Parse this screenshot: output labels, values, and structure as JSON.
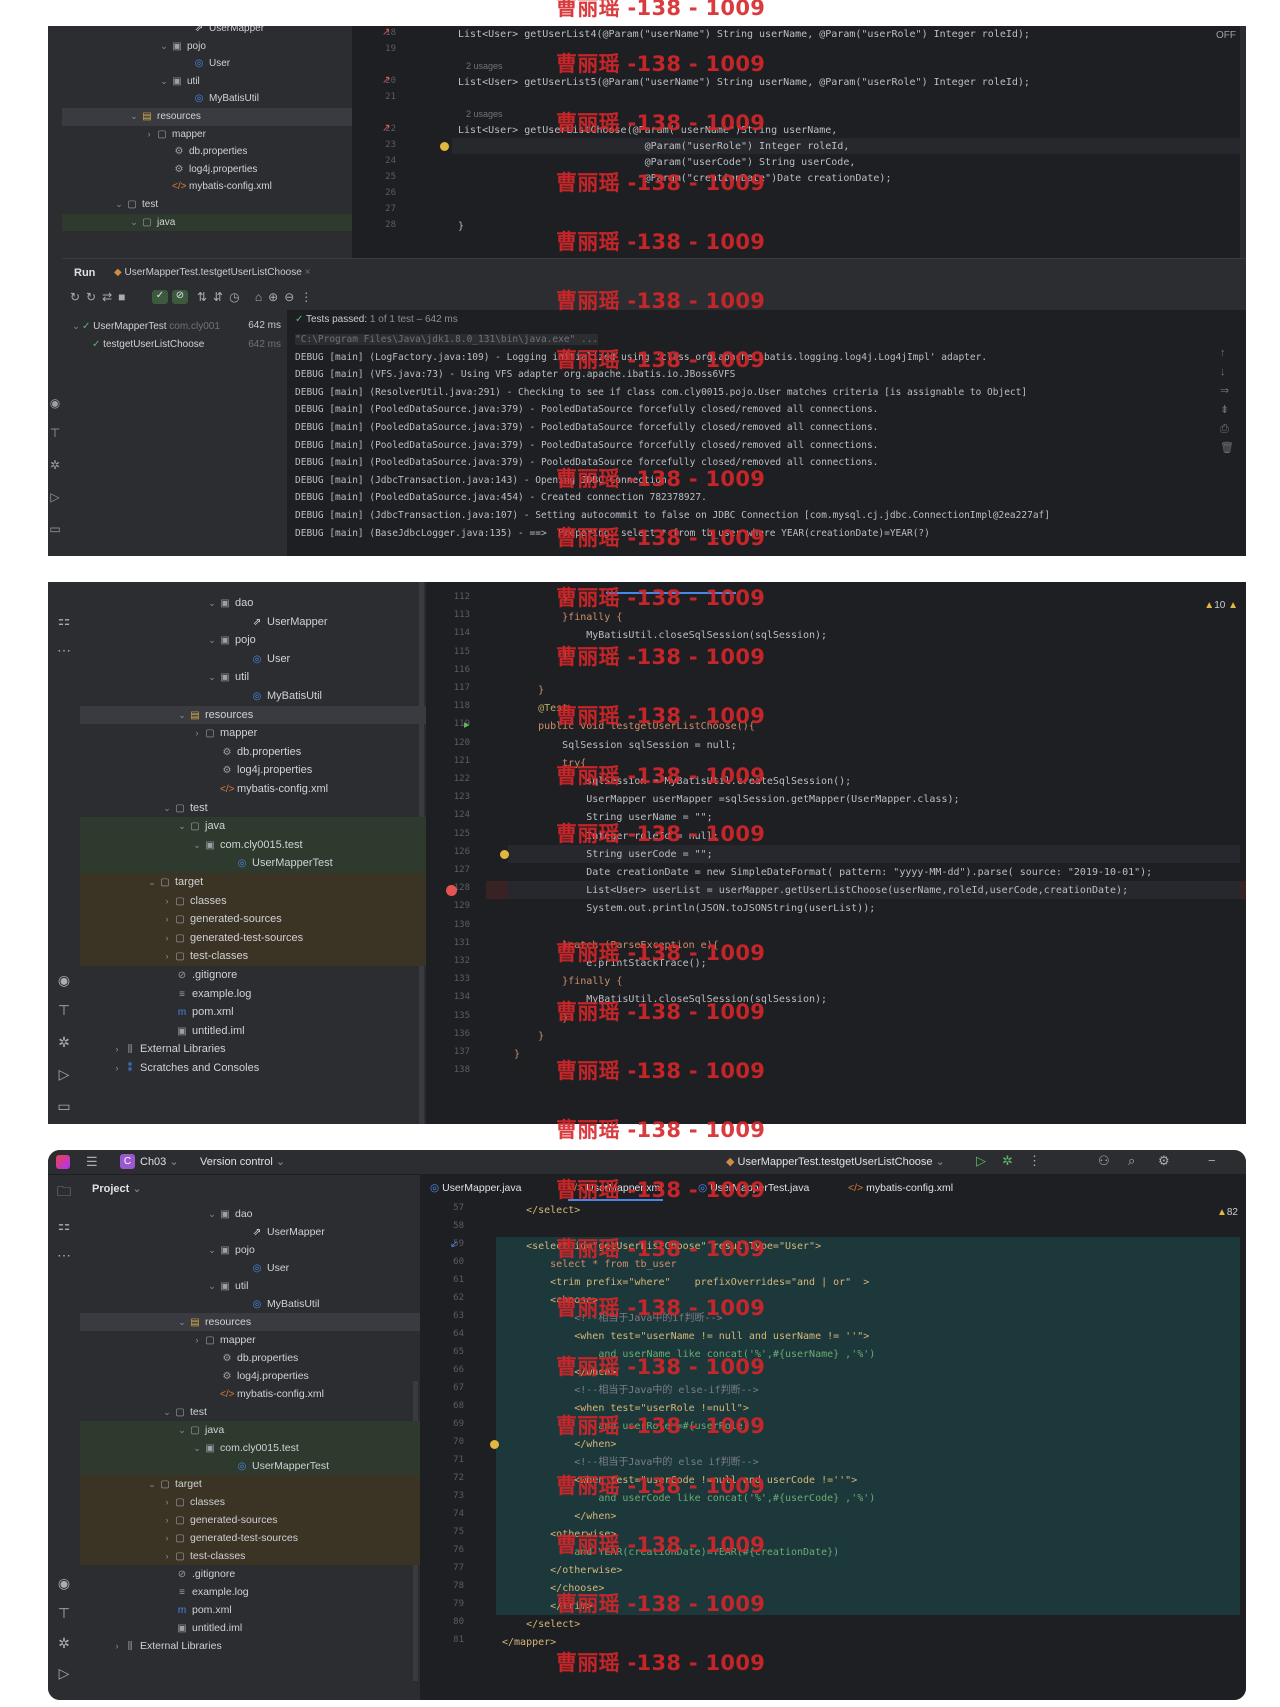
{
  "watermark": "曹丽瑶 -138 - 1009",
  "panel1": {
    "tree": [
      {
        "label": "UserMapper",
        "indent": 130,
        "icon": "mapper"
      },
      {
        "label": "pojo",
        "indent": 110,
        "icon": "pkg",
        "arrow": "v"
      },
      {
        "label": "User",
        "indent": 130,
        "icon": "class"
      },
      {
        "label": "util",
        "indent": 110,
        "icon": "pkg",
        "arrow": "v"
      },
      {
        "label": "MyBatisUtil",
        "indent": 130,
        "icon": "class"
      },
      {
        "label": "resources",
        "indent": 80,
        "icon": "res",
        "arrow": "v",
        "sel": true
      },
      {
        "label": "mapper",
        "indent": 95,
        "icon": "folder",
        "arrow": ">"
      },
      {
        "label": "db.properties",
        "indent": 110,
        "icon": "prop"
      },
      {
        "label": "log4j.properties",
        "indent": 110,
        "icon": "prop"
      },
      {
        "label": "mybatis-config.xml",
        "indent": 110,
        "icon": "xml"
      },
      {
        "label": "test",
        "indent": 65,
        "icon": "folder",
        "arrow": "v"
      },
      {
        "label": "java",
        "indent": 80,
        "icon": "folder",
        "arrow": "v",
        "green": true
      }
    ],
    "lines": [
      {
        "n": "18",
        "text": "List<User> getUserList4(@Param(\"userName\") String userName, @Param(\"userRole\") Integer roleId);"
      },
      {
        "n": "19",
        "text": ""
      },
      {
        "n": "",
        "hint": "2 usages"
      },
      {
        "n": "20",
        "text": "List<User> getUserList5(@Param(\"userName\") String userName, @Param(\"userRole\") Integer roleId);"
      },
      {
        "n": "21",
        "text": ""
      },
      {
        "n": "",
        "hint": "2 usages"
      },
      {
        "n": "22",
        "text": "List<User> getUserListChoose(@Param(\"userName\")String userName,"
      },
      {
        "n": "23",
        "text": "                               @Param(\"userRole\") Integer roleId,"
      },
      {
        "n": "24",
        "text": "                               @Param(\"userCode\") String userCode,"
      },
      {
        "n": "25",
        "text": "                               @Param(\"creationDate\")Date creationDate);"
      },
      {
        "n": "26",
        "text": ""
      },
      {
        "n": "27",
        "text": ""
      },
      {
        "n": "28",
        "text": "}"
      }
    ],
    "off_label": "OFF",
    "run_label": "Run",
    "run_tab": "UserMapperTest.testgetUserListChoose",
    "tests": [
      {
        "label": "UserMapperTest",
        "pkg": "com.cly001",
        "time": "642 ms"
      },
      {
        "label": "testgetUserListChoose",
        "pkg": "",
        "time": "642 ms"
      }
    ],
    "tests_passed": "Tests passed:",
    "tests_passed_detail": "1 of 1 test – 642 ms",
    "console": [
      "\"C:\\Program Files\\Java\\jdk1.8.0_131\\bin\\java.exe\" ...",
      "DEBUG [main] (LogFactory.java:109) - Logging initialized using 'class org.apache.ibatis.logging.log4j.Log4jImpl' adapter.",
      "DEBUG [main] (VFS.java:73) - Using VFS adapter org.apache.ibatis.io.JBoss6VFS",
      "DEBUG [main] (ResolverUtil.java:291) - Checking to see if class com.cly0015.pojo.User matches criteria [is assignable to Object]",
      "DEBUG [main] (PooledDataSource.java:379) - PooledDataSource forcefully closed/removed all connections.",
      "DEBUG [main] (PooledDataSource.java:379) - PooledDataSource forcefully closed/removed all connections.",
      "DEBUG [main] (PooledDataSource.java:379) - PooledDataSource forcefully closed/removed all connections.",
      "DEBUG [main] (PooledDataSource.java:379) - PooledDataSource forcefully closed/removed all connections.",
      "DEBUG [main] (JdbcTransaction.java:143) - Opening JDBC Connection",
      "DEBUG [main] (PooledDataSource.java:454) - Created connection 782378927.",
      "DEBUG [main] (JdbcTransaction.java:107) - Setting autocommit to false on JDBC Connection [com.mysql.cj.jdbc.ConnectionImpl@2ea227af]",
      "DEBUG [main] (BaseJdbcLogger.java:135) - ==>  Preparing: select * from tb_user where YEAR(creationDate)=YEAR(?)"
    ]
  },
  "panel2": {
    "tree": [
      {
        "label": "dao",
        "indent": 140,
        "icon": "pkg",
        "arrow": "v"
      },
      {
        "label": "UserMapper",
        "indent": 170,
        "icon": "mapper"
      },
      {
        "label": "pojo",
        "indent": 140,
        "icon": "pkg",
        "arrow": "v"
      },
      {
        "label": "User",
        "indent": 170,
        "icon": "class"
      },
      {
        "label": "util",
        "indent": 140,
        "icon": "pkg",
        "arrow": "v"
      },
      {
        "label": "MyBatisUtil",
        "indent": 170,
        "icon": "class"
      },
      {
        "label": "resources",
        "indent": 110,
        "icon": "res",
        "arrow": "v",
        "sel": true
      },
      {
        "label": "mapper",
        "indent": 125,
        "icon": "folder",
        "arrow": ">"
      },
      {
        "label": "db.properties",
        "indent": 140,
        "icon": "prop"
      },
      {
        "label": "log4j.properties",
        "indent": 140,
        "icon": "prop"
      },
      {
        "label": "mybatis-config.xml",
        "indent": 140,
        "icon": "xml"
      },
      {
        "label": "test",
        "indent": 95,
        "icon": "folder",
        "arrow": "v"
      },
      {
        "label": "java",
        "indent": 110,
        "icon": "folder",
        "arrow": "v",
        "green": true
      },
      {
        "label": "com.cly0015.test",
        "indent": 125,
        "icon": "pkg",
        "arrow": "v",
        "green": true
      },
      {
        "label": "UserMapperTest",
        "indent": 155,
        "icon": "class",
        "green": true
      },
      {
        "label": "target",
        "indent": 80,
        "icon": "folder",
        "arrow": "v",
        "orange": true
      },
      {
        "label": "classes",
        "indent": 95,
        "icon": "folder",
        "arrow": ">",
        "orange": true
      },
      {
        "label": "generated-sources",
        "indent": 95,
        "icon": "folder",
        "arrow": ">",
        "orange": true
      },
      {
        "label": "generated-test-sources",
        "indent": 95,
        "icon": "folder",
        "arrow": ">",
        "orange": true
      },
      {
        "label": "test-classes",
        "indent": 95,
        "icon": "folder",
        "arrow": ">",
        "orange": true
      },
      {
        "label": ".gitignore",
        "indent": 95,
        "icon": "ignore"
      },
      {
        "label": "example.log",
        "indent": 95,
        "icon": "log"
      },
      {
        "label": "pom.xml",
        "indent": 95,
        "icon": "maven"
      },
      {
        "label": "untitled.iml",
        "indent": 95,
        "icon": "iml"
      },
      {
        "label": "External Libraries",
        "indent": 45,
        "icon": "lib",
        "arrow": ">"
      },
      {
        "label": "Scratches and Consoles",
        "indent": 45,
        "icon": "scratch",
        "arrow": ">"
      }
    ],
    "warn_count": "10",
    "lines": [
      {
        "n": "112",
        "text": "        }"
      },
      {
        "n": "113",
        "text": "        }finally {"
      },
      {
        "n": "114",
        "text": "            MyBatisUtil.closeSqlSession(sqlSession);"
      },
      {
        "n": "115",
        "text": "        }"
      },
      {
        "n": "116",
        "text": ""
      },
      {
        "n": "117",
        "text": "    }"
      },
      {
        "n": "118",
        "text": "    @Test"
      },
      {
        "n": "119",
        "text": "    public void testgetUserListChoose(){"
      },
      {
        "n": "120",
        "text": "        SqlSession sqlSession = null;"
      },
      {
        "n": "121",
        "text": "        try{"
      },
      {
        "n": "122",
        "text": "            sqlSession = MyBatisUtil.createSqlSession();"
      },
      {
        "n": "123",
        "text": "            UserMapper userMapper =sqlSession.getMapper(UserMapper.class);"
      },
      {
        "n": "124",
        "text": "            String userName = \"\";"
      },
      {
        "n": "125",
        "text": "            Integer roleId = null;"
      },
      {
        "n": "126",
        "text": "            String userCode = \"\";"
      },
      {
        "n": "127",
        "text": "            Date creationDate = new SimpleDateFormat( pattern: \"yyyy-MM-dd\").parse( source: \"2019-10-01\");"
      },
      {
        "n": "128",
        "text": "            List<User> userList = userMapper.getUserListChoose(userName,roleId,userCode,creationDate);"
      },
      {
        "n": "129",
        "text": "            System.out.println(JSON.toJSONString(userList));"
      },
      {
        "n": "130",
        "text": ""
      },
      {
        "n": "131",
        "text": "        }catch (ParseException e){"
      },
      {
        "n": "132",
        "text": "            e.printStackTrace();"
      },
      {
        "n": "133",
        "text": "        }finally {"
      },
      {
        "n": "134",
        "text": "            MyBatisUtil.closeSqlSession(sqlSession);"
      },
      {
        "n": "135",
        "text": "        }"
      },
      {
        "n": "136",
        "text": "    }"
      },
      {
        "n": "137",
        "text": "}"
      },
      {
        "n": "138",
        "text": ""
      }
    ]
  },
  "panel3": {
    "titlebar": {
      "project": "Ch03",
      "vcs": "Version control",
      "run_config": "UserMapperTest.testgetUserListChoose"
    },
    "project_label": "Project",
    "tabs": [
      "UserMapper.java",
      "UserMapper.xml",
      "UserMapperTest.java",
      "mybatis-config.xml"
    ],
    "active_tab": 1,
    "warn_count": "82",
    "tree": [
      {
        "label": "dao",
        "indent": 140,
        "icon": "pkg",
        "arrow": "v"
      },
      {
        "label": "UserMapper",
        "indent": 170,
        "icon": "mapper"
      },
      {
        "label": "pojo",
        "indent": 140,
        "icon": "pkg",
        "arrow": "v"
      },
      {
        "label": "User",
        "indent": 170,
        "icon": "class"
      },
      {
        "label": "util",
        "indent": 140,
        "icon": "pkg",
        "arrow": "v"
      },
      {
        "label": "MyBatisUtil",
        "indent": 170,
        "icon": "class"
      },
      {
        "label": "resources",
        "indent": 110,
        "icon": "res",
        "arrow": "v",
        "sel": true
      },
      {
        "label": "mapper",
        "indent": 125,
        "icon": "folder",
        "arrow": ">"
      },
      {
        "label": "db.properties",
        "indent": 140,
        "icon": "prop"
      },
      {
        "label": "log4j.properties",
        "indent": 140,
        "icon": "prop"
      },
      {
        "label": "mybatis-config.xml",
        "indent": 140,
        "icon": "xml"
      },
      {
        "label": "test",
        "indent": 95,
        "icon": "folder",
        "arrow": "v"
      },
      {
        "label": "java",
        "indent": 110,
        "icon": "folder",
        "arrow": "v",
        "green": true
      },
      {
        "label": "com.cly0015.test",
        "indent": 125,
        "icon": "pkg",
        "arrow": "v",
        "green": true
      },
      {
        "label": "UserMapperTest",
        "indent": 155,
        "icon": "class",
        "green": true
      },
      {
        "label": "target",
        "indent": 80,
        "icon": "folder",
        "arrow": "v",
        "orange": true
      },
      {
        "label": "classes",
        "indent": 95,
        "icon": "folder",
        "arrow": ">",
        "orange": true
      },
      {
        "label": "generated-sources",
        "indent": 95,
        "icon": "folder",
        "arrow": ">",
        "orange": true
      },
      {
        "label": "generated-test-sources",
        "indent": 95,
        "icon": "folder",
        "arrow": ">",
        "orange": true
      },
      {
        "label": "test-classes",
        "indent": 95,
        "icon": "folder",
        "arrow": ">",
        "orange": true
      },
      {
        "label": ".gitignore",
        "indent": 95,
        "icon": "ignore"
      },
      {
        "label": "example.log",
        "indent": 95,
        "icon": "log"
      },
      {
        "label": "pom.xml",
        "indent": 95,
        "icon": "maven"
      },
      {
        "label": "untitled.iml",
        "indent": 95,
        "icon": "iml"
      },
      {
        "label": "External Libraries",
        "indent": 45,
        "icon": "lib",
        "arrow": ">"
      }
    ],
    "lines": [
      {
        "n": "57",
        "text": "    </select>"
      },
      {
        "n": "58",
        "text": ""
      },
      {
        "n": "59",
        "text": "    <select id=\"getUserListChoose\" resultType=\"User\">"
      },
      {
        "n": "60",
        "text": "        select * from tb_user"
      },
      {
        "n": "61",
        "text": "        <trim prefix=\"where\"    prefixOverrides=\"and | or\"  >"
      },
      {
        "n": "62",
        "text": "        <choose>"
      },
      {
        "n": "63",
        "text": "            <!--相当于Java中的if判断-->"
      },
      {
        "n": "64",
        "text": "            <when test=\"userName != null and userName != ''\">"
      },
      {
        "n": "65",
        "text": "                and userName like concat('%',#{userName} ,'%')"
      },
      {
        "n": "66",
        "text": "            </when>"
      },
      {
        "n": "67",
        "text": "            <!--相当于Java中的 else-if判断-->"
      },
      {
        "n": "68",
        "text": "            <when test=\"userRole !=null\">"
      },
      {
        "n": "69",
        "text": "                and userRole =#{userRole}"
      },
      {
        "n": "70",
        "text": "            </when>"
      },
      {
        "n": "71",
        "text": "            <!--相当于Java中的 else if判断-->"
      },
      {
        "n": "72",
        "text": "            <when test=\"userCode !=null and userCode !=''\">"
      },
      {
        "n": "73",
        "text": "                and userCode like concat('%',#{userCode} ,'%')"
      },
      {
        "n": "74",
        "text": "            </when>"
      },
      {
        "n": "75",
        "text": "        <otherwise>"
      },
      {
        "n": "76",
        "text": "            and YEAR(creationDate)=YEAR(#{creationDate})"
      },
      {
        "n": "77",
        "text": "        </otherwise>"
      },
      {
        "n": "78",
        "text": "        </choose>"
      },
      {
        "n": "79",
        "text": "        </trim>"
      },
      {
        "n": "80",
        "text": "    </select>"
      },
      {
        "n": "81",
        "text": "</mapper>"
      }
    ]
  }
}
